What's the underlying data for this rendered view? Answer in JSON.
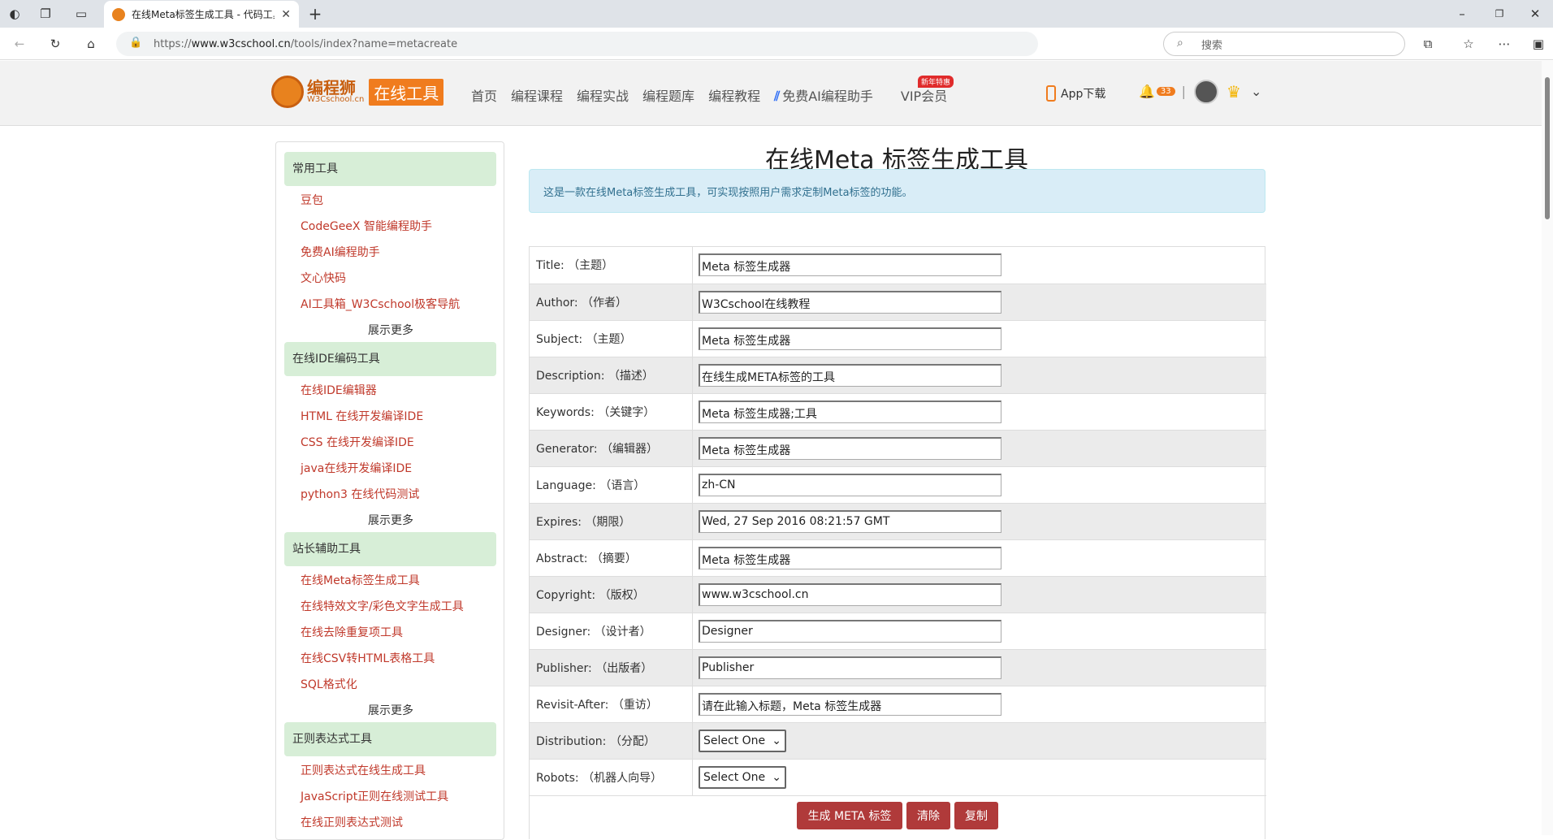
{
  "browser": {
    "tab_title": "在线Meta标签生成工具 - 代码工具",
    "url_prefix": "https://",
    "url_host": "www.w3cschool.cn",
    "url_path": "/tools/index?name=metacreate",
    "search_placeholder": "搜索"
  },
  "site": {
    "logo_cn": "编程狮",
    "logo_en": "W3Cschool.cn",
    "logo_tag": "在线工具",
    "nav": [
      "首页",
      "编程课程",
      "编程实战",
      "编程题库",
      "编程教程",
      "免费AI编程助手",
      "VIP会员"
    ],
    "vip_badge": "新年特惠",
    "app_download": "App下载",
    "notif_count": "33"
  },
  "sidebar": {
    "sections": [
      {
        "title": "常用工具",
        "links": [
          "豆包",
          "CodeGeeX 智能编程助手",
          "免费AI编程助手",
          "文心快码",
          "AI工具箱_W3Cschool极客导航"
        ],
        "more": "展示更多"
      },
      {
        "title": "在线IDE编码工具",
        "links": [
          "在线IDE编辑器",
          "HTML 在线开发编译IDE",
          "CSS 在线开发编译IDE",
          "java在线开发编译IDE",
          "python3 在线代码测试"
        ],
        "more": "展示更多"
      },
      {
        "title": "站长辅助工具",
        "links": [
          "在线Meta标签生成工具",
          "在线特效文字/彩色文字生成工具",
          "在线去除重复项工具",
          "在线CSV转HTML表格工具",
          "SQL格式化"
        ],
        "more": "展示更多"
      },
      {
        "title": "正则表达式工具",
        "links": [
          "正则表达式在线生成工具",
          "JavaScript正则在线测试工具",
          "在线正则表达式测试"
        ]
      }
    ]
  },
  "main": {
    "title": "在线Meta 标签生成工具",
    "info": "这是一款在线Meta标签生成工具，可实现按照用户需求定制Meta标签的功能。",
    "fields": [
      {
        "label": "Title: （主题）",
        "value": "Meta 标签生成器"
      },
      {
        "label": "Author: （作者）",
        "value": "W3Cschool在线教程"
      },
      {
        "label": "Subject: （主题）",
        "value": "Meta 标签生成器"
      },
      {
        "label": "Description: （描述）",
        "value": "在线生成META标签的工具"
      },
      {
        "label": "Keywords: （关键字）",
        "value": "Meta 标签生成器;工具"
      },
      {
        "label": "Generator: （编辑器）",
        "value": "Meta 标签生成器"
      },
      {
        "label": "Language: （语言）",
        "value": "zh-CN"
      },
      {
        "label": "Expires: （期限）",
        "value": "Wed, 27 Sep 2016 08:21:57 GMT"
      },
      {
        "label": "Abstract: （摘要）",
        "value": "Meta 标签生成器"
      },
      {
        "label": "Copyright: （版权）",
        "value": "www.w3cschool.cn"
      },
      {
        "label": "Designer: （设计者）",
        "value": "Designer"
      },
      {
        "label": "Publisher: （出版者）",
        "value": "Publisher"
      },
      {
        "label": "Revisit-After: （重访）",
        "value": "请在此输入标题，Meta 标签生成器"
      }
    ],
    "selects": [
      {
        "label": "Distribution: （分配）",
        "value": "Select One"
      },
      {
        "label": "Robots: （机器人向导）",
        "value": "Select One"
      }
    ],
    "buttons": {
      "generate": "生成 META 标签",
      "clear": "清除",
      "copy": "复制"
    }
  }
}
